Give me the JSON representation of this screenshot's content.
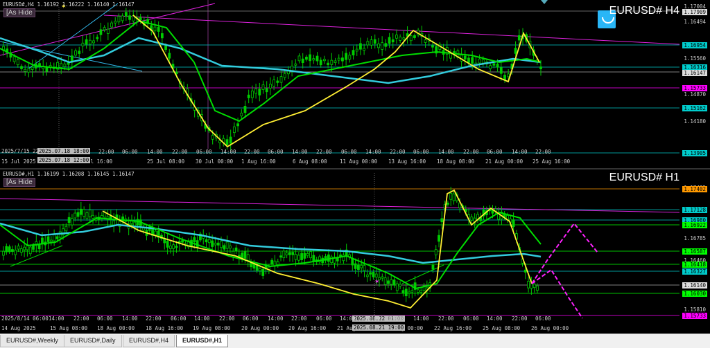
{
  "top_chart": {
    "title": "EURUSD#,H4  1.16192 1.16222 1.16140 1.16147",
    "as_hide": "[As Hide",
    "symbol": "EURUSD# H4",
    "price_ticks": [
      "1.17004",
      "1.16494",
      "1.15560",
      "1.14870",
      "1.14180"
    ],
    "price_labels": [
      {
        "text": "1.17909",
        "bg": "#dddddd",
        "fg": "#000000"
      },
      {
        "text": "1.16954",
        "bg": "#00cccc",
        "fg": "#000000"
      },
      {
        "text": "1.16316",
        "bg": "#00cccc",
        "fg": "#000000"
      },
      {
        "text": "1.16147",
        "bg": "#dddddd",
        "fg": "#000000"
      },
      {
        "text": "1.15733",
        "bg": "#ff00ff",
        "fg": "#000000"
      },
      {
        "text": "1.15162",
        "bg": "#00cccc",
        "fg": "#000000"
      },
      {
        "text": "1.13905",
        "bg": "#00cccc",
        "fg": "#000000"
      }
    ],
    "time_labels": [
      "15 Jul 2025",
      "22 Jul 16:00",
      "25 Jul 08:00",
      "30 Jul 00:00",
      "1 Aug 16:00",
      "6 Aug 08:00",
      "11 Aug 00:00",
      "13 Aug 16:00",
      "18 Aug 08:00",
      "21 Aug 00:00",
      "25 Aug 16:00"
    ],
    "cross_time_left": "2025/7/15 22:0",
    "cross_time_box": "2025.07.18 18:00",
    "cross_time_box2": "2025.07.18 12:00",
    "hours": [
      "22:00",
      "06:00",
      "14:00",
      "22:00",
      "06:00",
      "14:00",
      "22:00",
      "06:00",
      "14:00",
      "22:00",
      "06:00",
      "14:00",
      "22:00",
      "06:00",
      "14:00",
      "22:00",
      "06:00",
      "14:00",
      "22:00"
    ]
  },
  "bottom_chart": {
    "title": "EURUSD#,H1  1.16199 1.16208 1.16145 1.16147",
    "as_hide": "[As Hide",
    "symbol": "EURUSD# H1",
    "price_ticks": [
      "1.17425",
      "1.16785",
      "1.16460",
      "1.15810"
    ],
    "price_labels": [
      {
        "text": "1.17402",
        "bg": "#ff9900",
        "fg": "#000000"
      },
      {
        "text": "1.17128",
        "bg": "#00cccc",
        "fg": "#000000"
      },
      {
        "text": "1.16980",
        "bg": "#00cccc",
        "fg": "#000000"
      },
      {
        "text": "1.16922",
        "bg": "#00ff00",
        "fg": "#000000"
      },
      {
        "text": "1.16587",
        "bg": "#00ff00",
        "fg": "#000000"
      },
      {
        "text": "1.16418",
        "bg": "#00ff00",
        "fg": "#000000"
      },
      {
        "text": "1.16327",
        "bg": "#00cccc",
        "fg": "#000000"
      },
      {
        "text": "1.16140",
        "bg": "#dddddd",
        "fg": "#000000"
      },
      {
        "text": "1.16030",
        "bg": "#00ff00",
        "fg": "#000000"
      },
      {
        "text": "1.15733",
        "bg": "#ff00ff",
        "fg": "#000000"
      }
    ],
    "time_labels": [
      "14 Aug 2025",
      "15 Aug 08:00",
      "18 Aug 00:00",
      "18 Aug 16:00",
      "19 Aug 08:00",
      "20 Aug 00:00",
      "20 Aug 16:00",
      "21 Aug 08:00",
      "22 Aug 00:00",
      "22 Aug 16:00",
      "25 Aug 08:00",
      "26 Aug 00:00"
    ],
    "cross_time_left": "2025/8/14 06:00",
    "cross_time_box": "2025.08.22 01:00",
    "cross_time_box2": "2025.08.21 19:00",
    "hours": [
      "14:00",
      "22:00",
      "06:00",
      "14:00",
      "22:00",
      "06:00",
      "14:00",
      "22:00",
      "06:00",
      "14:00",
      "22:00",
      "06:00",
      "14:00",
      "22:00",
      "06:00",
      "14:00",
      "22:00",
      "06:00",
      "14:00",
      "22:00",
      "06:00"
    ]
  },
  "tabs": [
    {
      "label": "EURUSD#,Weekly",
      "active": false
    },
    {
      "label": "EURUSD#,Daily",
      "active": false
    },
    {
      "label": "EURUSD#,H4",
      "active": false
    },
    {
      "label": "EURUSD#,H1",
      "active": true
    }
  ],
  "colors": {
    "bg": "#000000",
    "candle": "#00cc00",
    "ma_fast": "#00dd00",
    "ma_slow": "#33ccdd",
    "zigzag": "#ffee33",
    "trend": "#dd22dd",
    "projection": "#ff22ff"
  }
}
